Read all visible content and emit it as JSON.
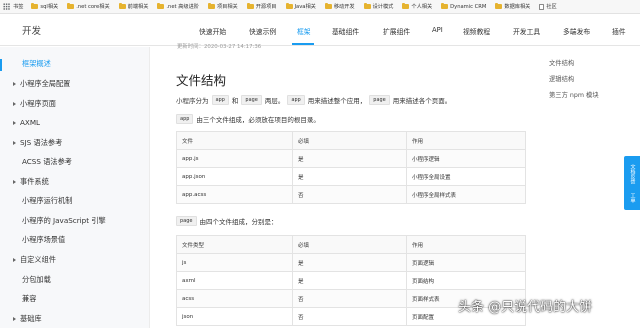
{
  "bookmarks": {
    "apps_label": "书签",
    "items": [
      {
        "label": "sql相关",
        "icon": "folder"
      },
      {
        "label": ".net core相关",
        "icon": "folder"
      },
      {
        "label": "前端相关",
        "icon": "folder"
      },
      {
        "label": ".net 高级进阶",
        "icon": "folder"
      },
      {
        "label": "项目相关",
        "icon": "folder"
      },
      {
        "label": "开源项目",
        "icon": "folder"
      },
      {
        "label": "Java相关",
        "icon": "folder"
      },
      {
        "label": "移动开发",
        "icon": "folder"
      },
      {
        "label": "设计模式",
        "icon": "folder"
      },
      {
        "label": "个人相关",
        "icon": "folder"
      },
      {
        "label": "Dynamic CRM",
        "icon": "folder"
      },
      {
        "label": "数据库相关",
        "icon": "folder"
      },
      {
        "label": "社区",
        "icon": "doc"
      }
    ]
  },
  "topnav": {
    "logo": "开发",
    "links": [
      "快速开始",
      "快速示例",
      "框架",
      "基础组件",
      "扩展组件",
      "API",
      "视频教程",
      "开发工具",
      "多端发布",
      "插件"
    ],
    "active_index": 2,
    "accent_color": "#1a9cf0"
  },
  "sidebar": {
    "items": [
      {
        "label": "框架概述",
        "caret": false,
        "active": true
      },
      {
        "label": "小程序全局配置",
        "caret": true
      },
      {
        "label": "小程序页面",
        "caret": true
      },
      {
        "label": "AXML",
        "caret": true
      },
      {
        "label": "SJS 语法参考",
        "caret": true
      },
      {
        "label": "ACSS 语法参考",
        "caret": false
      },
      {
        "label": "事件系统",
        "caret": true
      },
      {
        "label": "小程序运行机制",
        "caret": false
      },
      {
        "label": "小程序的 JavaScript 引擎",
        "caret": false
      },
      {
        "label": "小程序场景值",
        "caret": false
      },
      {
        "label": "自定义组件",
        "caret": true
      },
      {
        "label": "分包加载",
        "caret": false
      },
      {
        "label": "兼容",
        "caret": false
      },
      {
        "label": "基础库",
        "caret": true
      }
    ]
  },
  "content": {
    "updated": "更新时间：2020-03-27 14:17:36",
    "title": "文件结构",
    "intro": {
      "p1": "小程序分为",
      "code1": "app",
      "p2": "和",
      "code2": "page",
      "p3": "两层。",
      "code3": "app",
      "p4": "用来描述整个应用，",
      "code4": "page",
      "p5": "用来描述各个页面。"
    },
    "app_intro": {
      "code": "app",
      "text": "由三个文件组成，必须放在项目的根目录。"
    },
    "app_table": {
      "headers": [
        "文件",
        "必填",
        "作用"
      ],
      "rows": [
        [
          "app.js",
          "是",
          "小程序逻辑"
        ],
        [
          "app.json",
          "是",
          "小程序全局设置"
        ],
        [
          "app.acss",
          "否",
          "小程序全局样式表"
        ]
      ]
    },
    "page_intro": {
      "code": "page",
      "text": "由四个文件组成，分别是："
    },
    "page_table": {
      "headers": [
        "文件类型",
        "必填",
        "作用"
      ],
      "rows": [
        [
          "js",
          "是",
          "页面逻辑"
        ],
        [
          "axml",
          "是",
          "页面结构"
        ],
        [
          "acss",
          "否",
          "页面样式表"
        ],
        [
          "json",
          "否",
          "页面配置"
        ]
      ]
    }
  },
  "toc": {
    "items": [
      "文件结构",
      "逻辑结构",
      "第三方 npm 模块"
    ]
  },
  "float_buttons": {
    "labels": [
      "文档反馈",
      "工单"
    ]
  },
  "watermark": {
    "text": "头条 @只说代码的大饼"
  }
}
